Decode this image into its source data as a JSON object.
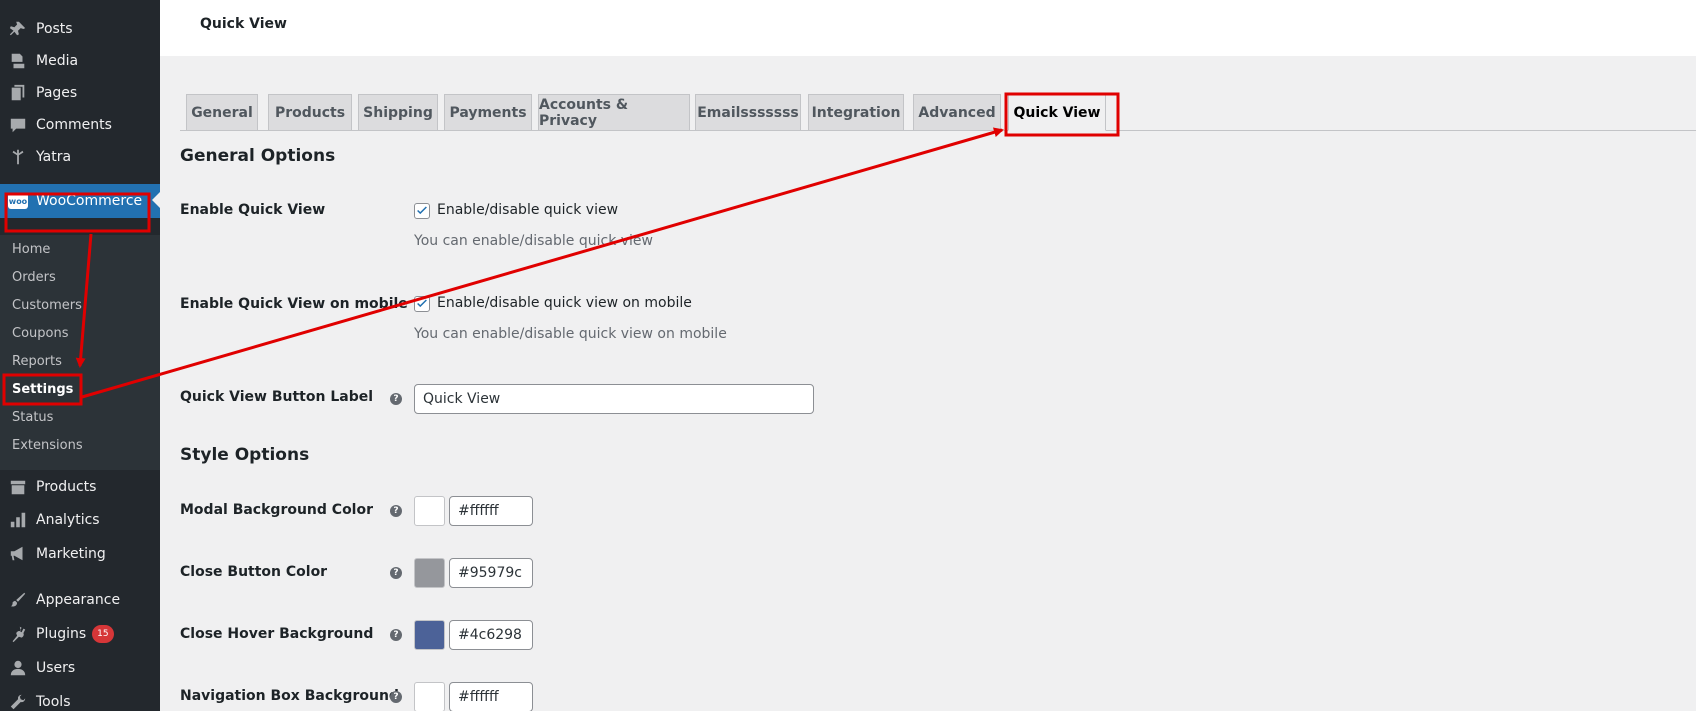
{
  "sidebar": {
    "items": [
      {
        "label": "Posts",
        "icon": "pushpin-icon"
      },
      {
        "label": "Media",
        "icon": "media-icon"
      },
      {
        "label": "Pages",
        "icon": "pages-icon"
      },
      {
        "label": "Comments",
        "icon": "comment-icon"
      },
      {
        "label": "Yatra",
        "icon": "yatra-icon"
      },
      {
        "label": "WooCommerce",
        "icon": "woo-icon"
      },
      {
        "label": "Products",
        "icon": "archive-icon"
      },
      {
        "label": "Analytics",
        "icon": "bar-chart-icon"
      },
      {
        "label": "Marketing",
        "icon": "megaphone-icon"
      },
      {
        "label": "Appearance",
        "icon": "paintbrush-icon"
      },
      {
        "label": "Plugins",
        "icon": "plug-icon",
        "badge": "15"
      },
      {
        "label": "Users",
        "icon": "user-icon"
      },
      {
        "label": "Tools",
        "icon": "wrench-icon"
      }
    ],
    "woo_submenu": [
      "Home",
      "Orders",
      "Customers",
      "Coupons",
      "Reports",
      "Settings",
      "Status",
      "Extensions"
    ],
    "woo_icon_text": "woo"
  },
  "header": {
    "title": "Quick View"
  },
  "tabs": [
    "General",
    "Products",
    "Shipping",
    "Payments",
    "Accounts & Privacy",
    "Emailsssssss",
    "Integration",
    "Advanced",
    "Quick View"
  ],
  "general": {
    "heading": "General Options",
    "enable_label": "Enable Quick View",
    "enable_checkbox": "Enable/disable quick view",
    "enable_desc": "You can enable/disable quick view",
    "mobile_label": "Enable Quick View on mobile",
    "mobile_checkbox": "Enable/disable quick view on mobile",
    "mobile_desc": "You can enable/disable quick view on mobile",
    "button_label": "Quick View Button Label",
    "button_value": "Quick View"
  },
  "style": {
    "heading": "Style Options",
    "rows": [
      {
        "label": "Modal Background Color",
        "value": "#ffffff"
      },
      {
        "label": "Close Button Color",
        "value": "#95979c"
      },
      {
        "label": "Close Hover Background",
        "value": "#4c6298"
      },
      {
        "label": "Navigation Box Background",
        "value": "#ffffff"
      }
    ]
  },
  "help_glyph": "?",
  "colors": {
    "sidebar": "#23282d",
    "accent": "#2271b1",
    "annotation": "#e00000"
  }
}
